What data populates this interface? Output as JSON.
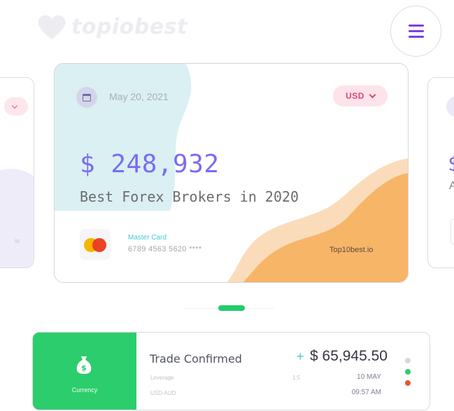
{
  "brand": {
    "logo_text": "topiobest",
    "logo_mark": "heart-logo"
  },
  "header": {
    "menu_icon": "hamburger-menu-icon",
    "accent_color": "#7b3fe4"
  },
  "side_left_card": {
    "fragment_text": "io"
  },
  "side_right_card": {
    "amount_fragment": "$",
    "subtitle_fragment": "A"
  },
  "card": {
    "date": "May 20, 2021",
    "currency": "USD",
    "amount": "$ 248,932",
    "tagline": "Best Forex Brokers in 2020",
    "card_type": "Master Card",
    "card_number": "6789 4563 5620 ****",
    "site": "Top10best.io",
    "colors": {
      "amount": "#7a6cf3",
      "blob": "#daf0f3",
      "wave": "#f7b568",
      "currency": "#e3417a"
    }
  },
  "pagination": {
    "active_index": 1
  },
  "trade": {
    "icon_label": "Currency",
    "title": "Trade Confirmed",
    "sign": "+",
    "amount": "$ 65,945.50",
    "leverage_label": "Leverage",
    "leverage_value": "1:5",
    "pair": "USD-AUD",
    "date": "10 MAY",
    "time": "09:57 AM",
    "status_dots": [
      "#d8d8d8",
      "#2ccd6c",
      "#e4572e"
    ]
  }
}
